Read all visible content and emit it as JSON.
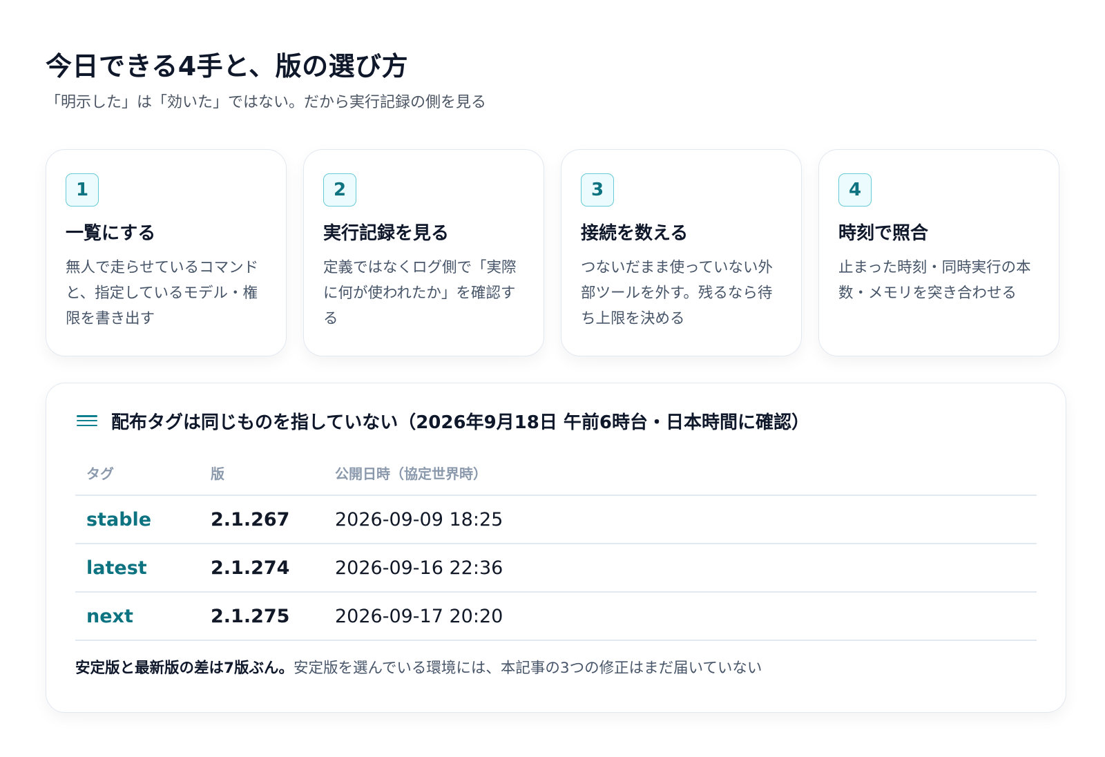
{
  "header": {
    "title": "今日できる4手と、版の選び方",
    "subtitle": "「明示した」は「効いた」ではない。だから実行記録の側を見る"
  },
  "cards": [
    {
      "num": "1",
      "title": "一覧にする",
      "body": "無人で走らせているコマンドと、指定しているモデル・権限を書き出す"
    },
    {
      "num": "2",
      "title": "実行記録を見る",
      "body": "定義ではなくログ側で「実際に何が使われたか」を確認する"
    },
    {
      "num": "3",
      "title": "接続を数える",
      "body": "つないだまま使っていない外部ツールを外す。残るなら待ち上限を決める"
    },
    {
      "num": "4",
      "title": "時刻で照合",
      "body": "止まった時刻・同時実行の本数・メモリを突き合わせる"
    }
  ],
  "panel": {
    "title": "配布タグは同じものを指していない（2026年9月18日 午前6時台・日本時間に確認）",
    "columns": [
      "タグ",
      "版",
      "公開日時（協定世界時）"
    ],
    "rows": [
      {
        "tag": "stable",
        "version": "2.1.267",
        "date": "2026-09-09 18:25"
      },
      {
        "tag": "latest",
        "version": "2.1.274",
        "date": "2026-09-16 22:36"
      },
      {
        "tag": "next",
        "version": "2.1.275",
        "date": "2026-09-17 20:20"
      }
    ],
    "note_strong": "安定版と最新版の差は7版ぶん。",
    "note_rest": "安定版を選んでいる環境には、本記事の3つの修正はまだ届いていない"
  },
  "colors": {
    "accent": "#0e7380",
    "badge_border": "#67cad6",
    "badge_bg": "#ecfbfd"
  }
}
